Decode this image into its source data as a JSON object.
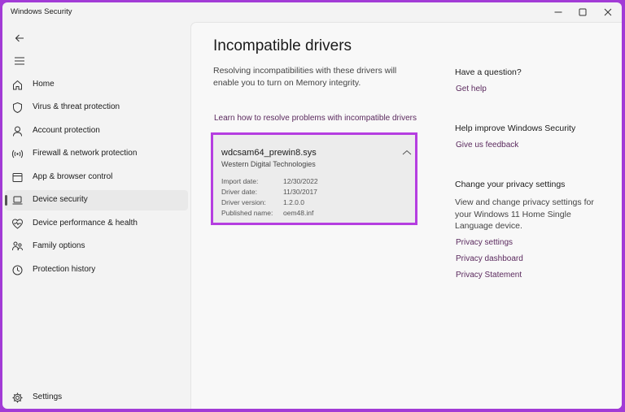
{
  "window": {
    "title": "Windows Security"
  },
  "sidebar": {
    "items": [
      {
        "label": "Home",
        "icon": "home-icon",
        "active": false
      },
      {
        "label": "Virus & threat protection",
        "icon": "shield-icon",
        "active": false
      },
      {
        "label": "Account protection",
        "icon": "person-icon",
        "active": false
      },
      {
        "label": "Firewall & network protection",
        "icon": "wireless-icon",
        "active": false
      },
      {
        "label": "App & browser control",
        "icon": "app-window-icon",
        "active": false
      },
      {
        "label": "Device security",
        "icon": "laptop-icon",
        "active": true
      },
      {
        "label": "Device performance & health",
        "icon": "heart-pulse-icon",
        "active": false
      },
      {
        "label": "Family options",
        "icon": "family-icon",
        "active": false
      },
      {
        "label": "Protection history",
        "icon": "history-icon",
        "active": false
      }
    ],
    "settings_label": "Settings"
  },
  "main": {
    "title": "Incompatible drivers",
    "description": "Resolving incompatibilities with these drivers will enable you to turn on Memory integrity.",
    "learn_link": "Learn how to resolve problems with incompatible drivers",
    "driver": {
      "name": "wdcsam64_prewin8.sys",
      "vendor": "Western Digital Technologies",
      "details": [
        {
          "label": "Import date:",
          "value": "12/30/2022"
        },
        {
          "label": "Driver date:",
          "value": "11/30/2017"
        },
        {
          "label": "Driver version:",
          "value": "1.2.0.0"
        },
        {
          "label": "Published name:",
          "value": "oem48.inf"
        }
      ]
    }
  },
  "side_panel": {
    "question_heading": "Have a question?",
    "get_help": "Get help",
    "improve_heading": "Help improve Windows Security",
    "feedback": "Give us feedback",
    "privacy_heading": "Change your privacy settings",
    "privacy_text": "View and change privacy settings for your Windows 11 Home Single Language device.",
    "privacy_links": [
      "Privacy settings",
      "Privacy dashboard",
      "Privacy Statement"
    ]
  },
  "colors": {
    "highlight_border": "#b53ee0",
    "link": "#5b2a5e",
    "frame": "#a23bd6"
  }
}
